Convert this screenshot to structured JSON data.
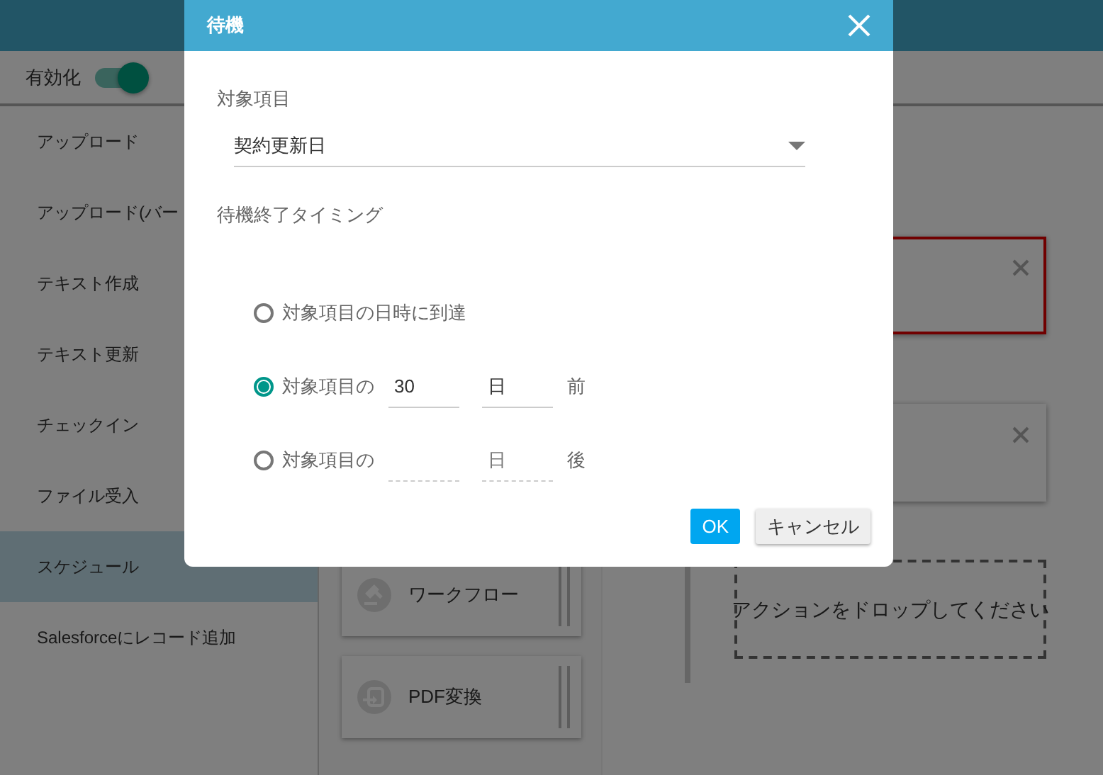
{
  "toolbar": {
    "toggle": {
      "label": "有効化",
      "on": true
    }
  },
  "sidebar": {
    "items": [
      {
        "label": "アップロード",
        "selected": false
      },
      {
        "label": "アップロード(バー",
        "selected": false
      },
      {
        "label": "テキスト作成",
        "selected": false
      },
      {
        "label": "テキスト更新",
        "selected": false
      },
      {
        "label": "チェックイン",
        "selected": false
      },
      {
        "label": "ファイル受入",
        "selected": false
      },
      {
        "label": "スケジュール",
        "selected": true
      },
      {
        "label": "Salesforceにレコード追加",
        "selected": false
      }
    ]
  },
  "palette": [
    {
      "label": "ワークフロー",
      "kind": "gavel"
    },
    {
      "label": "PDF変換",
      "kind": "convert"
    }
  ],
  "canvas": {
    "cards": [
      {
        "error": true
      },
      {
        "error": false
      }
    ],
    "drop_zone": "アクションをドロップしてください"
  },
  "dialog": {
    "title": "待機",
    "field_label": "対象項目",
    "select_value": "契約更新日",
    "timing_label": "待機終了タイミング",
    "options": [
      {
        "kind": "reach",
        "label": "対象項目の日時に到達",
        "selected": false
      },
      {
        "kind": "offset",
        "prefix": "対象項目の",
        "value": "30",
        "unit": "日",
        "suffix": "前",
        "selected": true
      },
      {
        "kind": "offset",
        "prefix": "対象項目の",
        "unit": "日",
        "suffix": "後",
        "selected": false
      }
    ],
    "buttons": [
      {
        "label": "OK",
        "kind": "primary"
      },
      {
        "label": "キャンセル",
        "kind": "secondary"
      }
    ]
  }
}
